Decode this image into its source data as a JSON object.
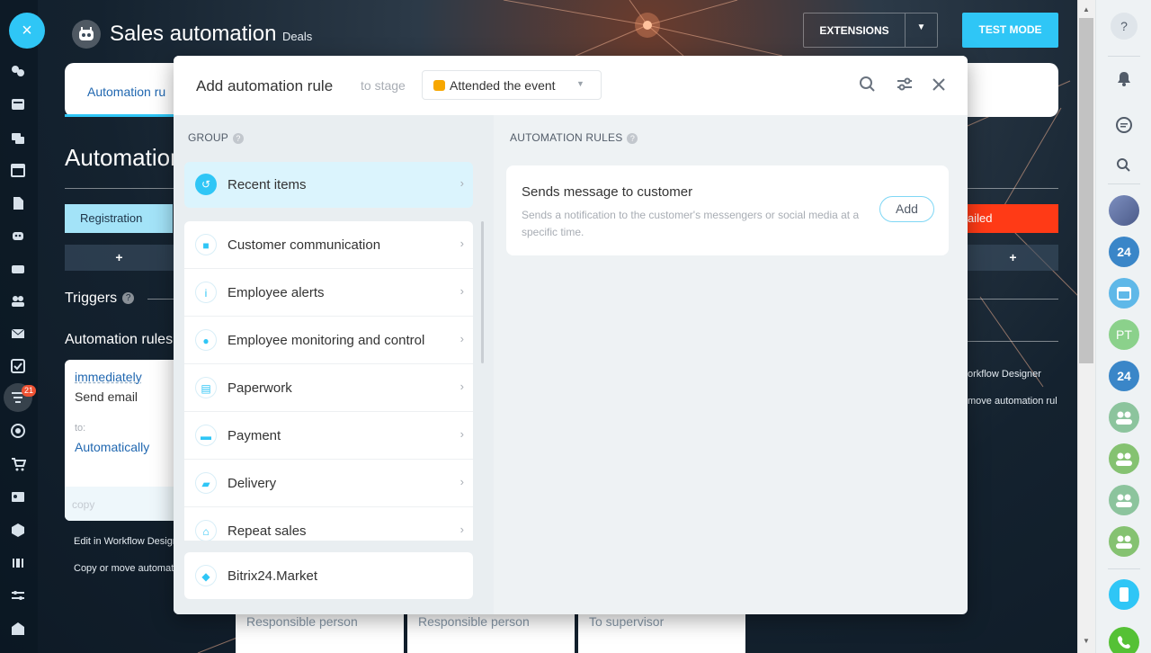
{
  "header": {
    "app_title": "Sales automation",
    "app_subtitle": "Deals",
    "extensions_label": "EXTENSIONS",
    "test_mode_label": "TEST MODE"
  },
  "leftnav": {
    "close_icon": "×",
    "badge_count": "21",
    "icons": [
      "chat-bubbles-icon",
      "feed-icon",
      "messages-icon",
      "calendar-icon",
      "document-icon",
      "robot-icon",
      "drive-icon",
      "users-icon",
      "mail-icon",
      "tasks-icon",
      "crm-filter-icon",
      "target-icon",
      "cart-icon",
      "contact-card-icon",
      "box-icon",
      "barcode-icon",
      "settings-sliders-icon",
      "building-icon"
    ]
  },
  "page": {
    "tab_active": "Automation ru",
    "heading": "Automation",
    "stage_registration": "Registration",
    "stage_failed": "ailed",
    "triggers_label": "Triggers",
    "automation_rules_label": "Automation rules",
    "plus": "+",
    "rule_card": {
      "when": "immediately",
      "action": "Send email",
      "to_label": "to:",
      "to_value": "Automatically",
      "copy": "copy"
    },
    "links": {
      "edit_left": "Edit in Workflow Design",
      "copy_left": "Copy or move automat",
      "edit_right": "orkflow Designer",
      "copy_right": "move automation rul"
    },
    "bottom_cols": [
      "Responsible person",
      "Responsible person",
      "To supervisor"
    ]
  },
  "modal": {
    "title": "Add automation rule",
    "to_stage": "to stage",
    "stage_value": "Attended the event",
    "stage_color": "#f7a700",
    "group_header": "GROUP",
    "rules_header": "AUTOMATION RULES",
    "recent": "Recent items",
    "groups": [
      {
        "label": "Customer communication",
        "icon": "chat-icon"
      },
      {
        "label": "Employee alerts",
        "icon": "info-icon"
      },
      {
        "label": "Employee monitoring and control",
        "icon": "people-icon"
      },
      {
        "label": "Paperwork",
        "icon": "document-icon"
      },
      {
        "label": "Payment",
        "icon": "wallet-icon"
      },
      {
        "label": "Delivery",
        "icon": "truck-icon"
      },
      {
        "label": "Repeat sales",
        "icon": "cart-icon"
      }
    ],
    "market": "Bitrix24.Market",
    "rule": {
      "title": "Sends message to customer",
      "description": "Sends a notification to the customer's messengers or social media at a specific time.",
      "add_label": "Add"
    }
  },
  "rightbar": {
    "help": "?",
    "avatar_pt": "PT",
    "badge_24": "24"
  },
  "colors": {
    "accent": "#2fc6f6",
    "failed": "#ff3a16",
    "stage": "#f7a700"
  }
}
